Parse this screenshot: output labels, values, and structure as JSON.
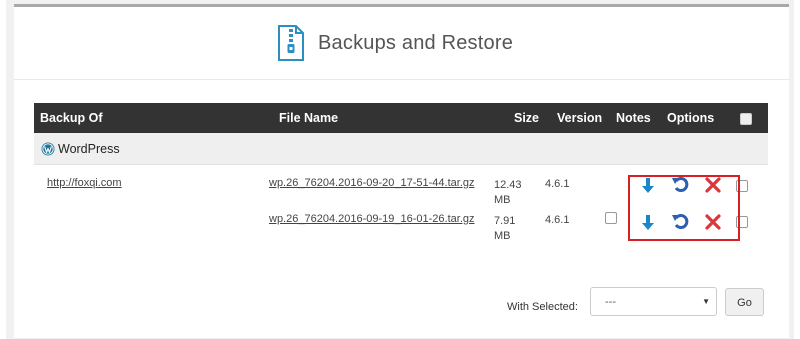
{
  "header": {
    "title": "Backups and Restore",
    "icon": "zip-file-icon"
  },
  "table": {
    "columns": [
      "Backup Of",
      "File Name",
      "Size",
      "Version",
      "Notes",
      "Options"
    ],
    "group": {
      "label": "WordPress",
      "icon": "wordpress-icon"
    },
    "rows": [
      {
        "backup_of": "http://foxqi.com",
        "file_name": "wp.26_76204.2016-09-20_17-51-44.tar.gz",
        "size_value": "12.43",
        "size_unit": "MB",
        "version": "4.6.1",
        "notes_checkbox": false
      },
      {
        "backup_of": "",
        "file_name": "wp.26_76204.2016-09-19_16-01-26.tar.gz",
        "size_value": "7.91",
        "size_unit": "MB",
        "version": "4.6.1",
        "notes_checkbox": true
      }
    ]
  },
  "actions": {
    "download_icon": "download-arrow-icon",
    "restore_icon": "restore-icon",
    "delete_icon": "delete-x-icon"
  },
  "footer": {
    "with_selected_label": "With Selected:",
    "select_value": "---",
    "go_label": "Go"
  },
  "colors": {
    "header_bg": "#333333",
    "download": "#1a87c9",
    "restore": "#2d5fb0",
    "delete": "#d9373a",
    "highlight": "#d71f26",
    "icon_teal": "#2b8fc4"
  }
}
